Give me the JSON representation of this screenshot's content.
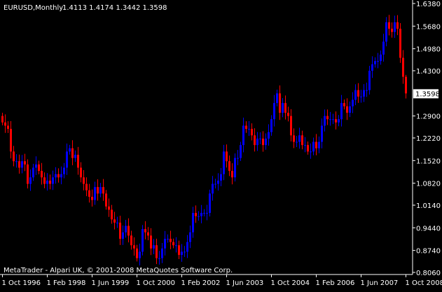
{
  "header": {
    "symbol": "EURUSD,Monthly",
    "ohlc": "1.4113 1.4174 1.3442 1.3598"
  },
  "footer": {
    "copyright": "MetaTrader - Alpari UK, © 2001-2008 MetaQuotes Software Corp."
  },
  "colors": {
    "background": "#000000",
    "axis": "#ffffff",
    "bull": "#0000ff",
    "bear": "#ff0000",
    "wick": "#808080"
  },
  "chart_data": {
    "type": "candlestick",
    "title": "EURUSD,Monthly",
    "ylim": [
      0.806,
      1.638
    ],
    "y_ticks": [
      "1.6380",
      "1.5680",
      "1.4980",
      "1.4300",
      "1.2900",
      "1.2220",
      "1.1520",
      "1.0820",
      "1.0140",
      "0.9440",
      "0.8740",
      "0.8060"
    ],
    "y_tick_values": [
      1.638,
      1.568,
      1.498,
      1.43,
      1.29,
      1.222,
      1.152,
      1.082,
      1.014,
      0.944,
      0.874,
      0.806
    ],
    "current_price": {
      "label": "1.3598",
      "value": 1.3598
    },
    "x_ticks": [
      "1 Oct 1996",
      "1 Feb 1998",
      "1 Jun 1999",
      "1 Oct 2000",
      "1 Feb 2002",
      "1 Jun 2003",
      "1 Oct 2004",
      "1 Feb 2006",
      "1 Jun 2007",
      "1 Oct 2008"
    ],
    "x_tick_every_months": 16,
    "start": "1 Oct 1996",
    "first_open": 1.29,
    "closes": [
      1.27,
      1.26,
      1.25,
      1.18,
      1.15,
      1.15,
      1.13,
      1.15,
      1.14,
      1.08,
      1.1,
      1.13,
      1.14,
      1.12,
      1.1,
      1.08,
      1.09,
      1.08,
      1.1,
      1.11,
      1.1,
      1.11,
      1.13,
      1.18,
      1.19,
      1.16,
      1.17,
      1.13,
      1.1,
      1.08,
      1.06,
      1.04,
      1.03,
      1.07,
      1.05,
      1.07,
      1.05,
      1.01,
      1.0,
      0.97,
      0.96,
      0.96,
      0.91,
      0.93,
      0.95,
      0.92,
      0.89,
      0.88,
      0.85,
      0.87,
      0.94,
      0.93,
      0.92,
      0.88,
      0.89,
      0.85,
      0.85,
      0.88,
      0.91,
      0.91,
      0.9,
      0.89,
      0.89,
      0.86,
      0.87,
      0.87,
      0.9,
      0.93,
      0.99,
      0.98,
      0.98,
      0.99,
      0.99,
      0.99,
      1.05,
      1.08,
      1.08,
      1.09,
      1.11,
      1.18,
      1.15,
      1.12,
      1.1,
      1.16,
      1.16,
      1.2,
      1.26,
      1.25,
      1.25,
      1.23,
      1.2,
      1.22,
      1.22,
      1.2,
      1.22,
      1.24,
      1.28,
      1.33,
      1.36,
      1.3,
      1.33,
      1.3,
      1.29,
      1.23,
      1.21,
      1.21,
      1.23,
      1.2,
      1.2,
      1.18,
      1.18,
      1.21,
      1.19,
      1.21,
      1.26,
      1.29,
      1.28,
      1.28,
      1.28,
      1.27,
      1.28,
      1.33,
      1.32,
      1.3,
      1.32,
      1.34,
      1.37,
      1.35,
      1.35,
      1.37,
      1.37,
      1.43,
      1.45,
      1.46,
      1.46,
      1.48,
      1.52,
      1.58,
      1.56,
      1.55,
      1.58,
      1.56,
      1.47,
      1.4113,
      1.3598
    ],
    "last_candle": {
      "open": 1.4113,
      "high": 1.4174,
      "low": 1.3442,
      "close": 1.3598
    }
  }
}
